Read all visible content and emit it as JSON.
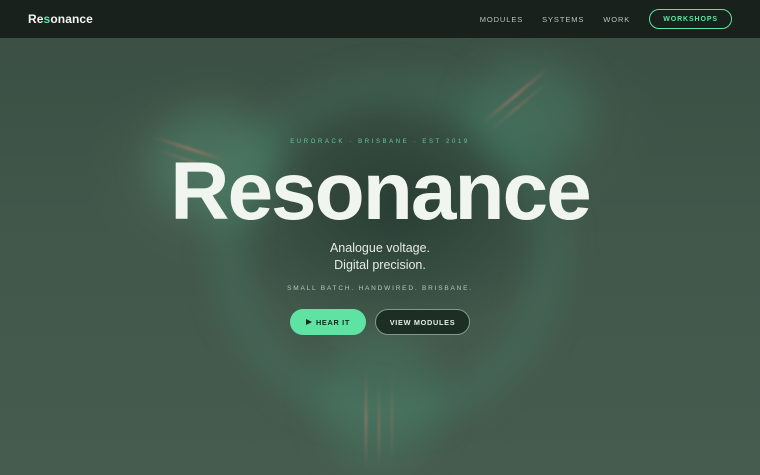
{
  "nav": {
    "logo_prefix": "Re",
    "logo_accent": "s",
    "logo_suffix": "onance",
    "links": [
      "MODULES",
      "SYSTEMS",
      "WORK"
    ],
    "cta": "WORKSHOPS"
  },
  "hero": {
    "eyebrow": "EURORACK · BRISBANE · EST 2019",
    "title": "Resonance",
    "tagline_line1": "Analogue voltage.",
    "tagline_line2": "Digital precision.",
    "subline": "SMALL BATCH. HANDWIRED. BRISBANE.",
    "primary_button": "HEAR IT",
    "secondary_button": "VIEW MODULES"
  },
  "colors": {
    "accent": "#5fe3a2",
    "nav_background": "#18211c",
    "hero_background": "#41574a"
  },
  "icons": {
    "primary_button_icon": "play-icon"
  }
}
